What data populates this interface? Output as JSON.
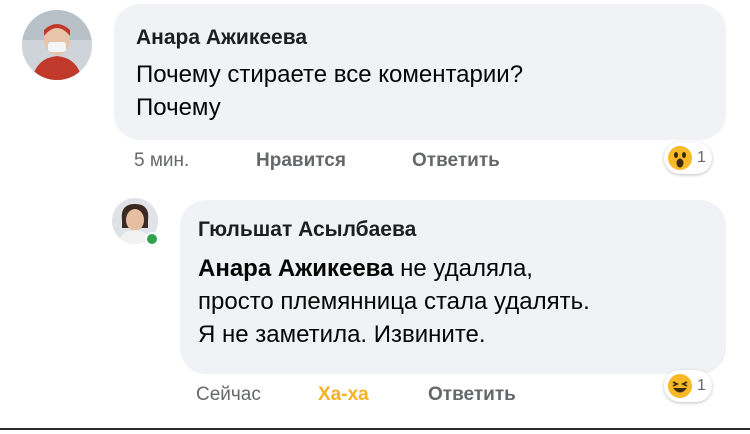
{
  "comments": [
    {
      "author": "Анара Ажикеева",
      "text": "Почему стираете все коментарии?\nПочему",
      "time": "5 мин.",
      "like_label": "Нравится",
      "reply_label": "Ответить",
      "reaction": {
        "icon": "wow-emoji-icon",
        "count": "1"
      }
    },
    {
      "author": "Гюльшат Асылбаева",
      "mention": "Анара Ажикеева",
      "text": " не удаляла,\nпросто племянница стала удалять.\nЯ не заметила. Извините.",
      "time": "Сейчас",
      "like_label": "Ха-ха",
      "reply_label": "Ответить",
      "reaction": {
        "icon": "haha-emoji-icon",
        "count": "1"
      }
    }
  ],
  "colors": {
    "bubble": "#f0f2f5",
    "meta_text": "#65676b",
    "haha_active": "#f7b125",
    "online": "#31a24c"
  }
}
